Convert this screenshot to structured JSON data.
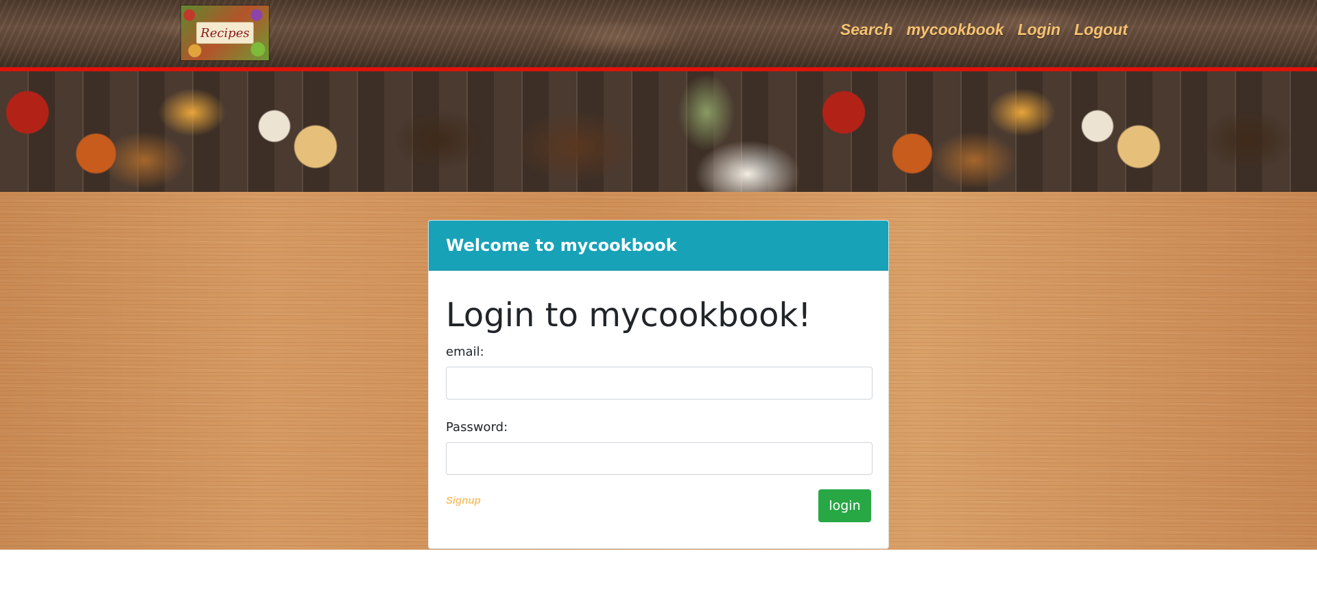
{
  "nav": {
    "logo_text": "Recipes",
    "links": [
      "Search",
      "mycookbook",
      "Login",
      "Logout"
    ]
  },
  "card": {
    "header": "Welcome to mycookbook",
    "title": "Login to mycookbook!",
    "email_label": "email:",
    "email_value": "",
    "password_label": "Password:",
    "password_value": "",
    "signup_label": "Signup",
    "login_label": "login"
  },
  "colors": {
    "header_accent": "#17a2b8",
    "login_button": "#28a745",
    "nav_link": "#f7c371",
    "nav_border": "#e0120c"
  }
}
